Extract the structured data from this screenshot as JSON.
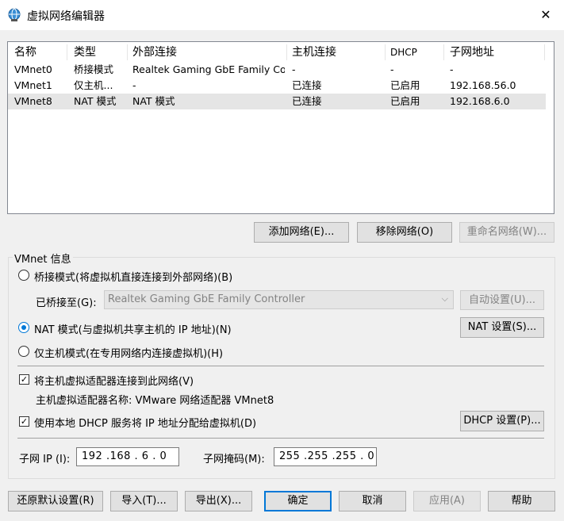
{
  "window": {
    "title": "虚拟网络编辑器",
    "close": "✕"
  },
  "table": {
    "headers": [
      "名称",
      "类型",
      "外部连接",
      "主机连接",
      "DHCP",
      "子网地址"
    ],
    "rows": [
      [
        "VMnet0",
        "桥接模式",
        "Realtek Gaming GbE Family Co...",
        "-",
        "-",
        "-"
      ],
      [
        "VMnet1",
        "仅主机...",
        "-",
        "已连接",
        "已启用",
        "192.168.56.0"
      ],
      [
        "VMnet8",
        "NAT 模式",
        "NAT 模式",
        "已连接",
        "已启用",
        "192.168.6.0"
      ]
    ],
    "selected_row": 2
  },
  "net_buttons": {
    "add": "添加网络(E)...",
    "remove": "移除网络(O)",
    "rename": "重命名网络(W)..."
  },
  "info": {
    "group_title": "VMnet 信息",
    "bridged_label": "桥接模式(将虚拟机直接连接到外部网络)(B)",
    "bridged_to_label": "已桥接至(G):",
    "bridged_to_value": "Realtek Gaming GbE Family Controller",
    "auto_button": "自动设置(U)...",
    "nat_label": "NAT 模式(与虚拟机共享主机的 IP 地址)(N)",
    "nat_button": "NAT 设置(S)...",
    "hostonly_label": "仅主机模式(在专用网络内连接虚拟机)(H)",
    "connect_adapter_label": "将主机虚拟适配器连接到此网络(V)",
    "adapter_name_text": "主机虚拟适配器名称: VMware 网络适配器 VMnet8",
    "dhcp_label": "使用本地 DHCP 服务将 IP 地址分配给虚拟机(D)",
    "dhcp_button": "DHCP 设置(P)...",
    "subnet_ip_label": "子网 IP (I):",
    "subnet_ip_value": "192 .168 . 6  . 0",
    "subnet_mask_label": "子网掩码(M):",
    "subnet_mask_value": "255 .255 .255 . 0",
    "mode_selected": "nat",
    "connect_adapter_checked": true,
    "dhcp_checked": true
  },
  "footer": {
    "restore": "还原默认设置(R)",
    "import": "导入(T)...",
    "export": "导出(X)...",
    "ok": "确定",
    "cancel": "取消",
    "apply": "应用(A)",
    "help": "帮助"
  },
  "colors": {
    "accent": "#0078d7",
    "selected_row": "#e5e5e5",
    "disabled_text": "#838383"
  },
  "icons": {
    "title": "network-globe-icon",
    "check": "✓",
    "dropdown": "⌵"
  }
}
